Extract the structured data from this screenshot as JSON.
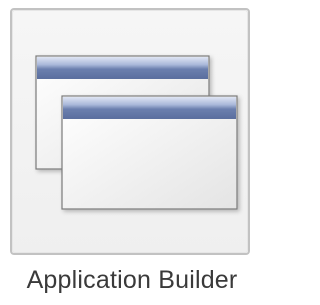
{
  "tile": {
    "label": "Application Builder",
    "icon": "stacked-windows-icon"
  },
  "colors": {
    "tile_border": "#c2c2c2",
    "tile_background": "#f3f3f3",
    "window_titlebar": "#6b7fae",
    "window_titlebar_light": "#c9d3ea",
    "window_body": "#f5f5f5",
    "window_border": "#7a7a7a",
    "label_text": "#3a3a3a"
  }
}
